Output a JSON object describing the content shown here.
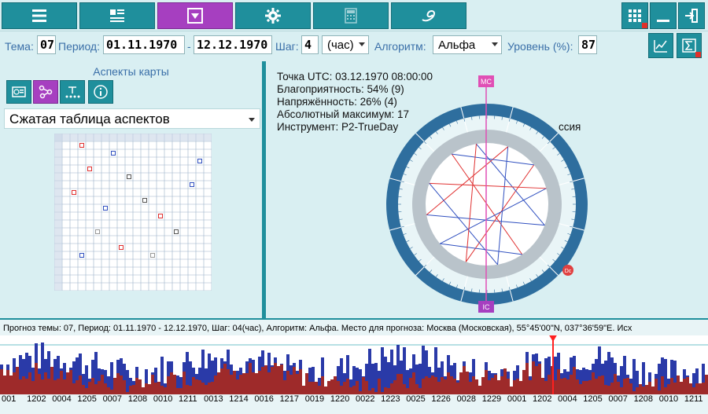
{
  "toolbar": {
    "buttons": [
      {
        "icon": "menu-icon"
      },
      {
        "icon": "list-icon"
      },
      {
        "icon": "dropdown-box-icon",
        "active": true
      },
      {
        "icon": "gear-icon"
      },
      {
        "icon": "calculator-icon"
      },
      {
        "icon": "logo-icon"
      }
    ],
    "right_buttons": [
      {
        "icon": "grid-icon"
      },
      {
        "icon": "minimize-icon"
      },
      {
        "icon": "exit-icon"
      }
    ]
  },
  "params": {
    "theme_label": "Тема:",
    "theme_value": "07",
    "period_label": "Период:",
    "period_from": "01.11.1970",
    "period_sep": "-",
    "period_to": "12.12.1970",
    "step_label": "Шаг:",
    "step_value": "4",
    "step_unit": "(час)",
    "algorithm_label": "Алгоритм:",
    "algorithm_value": "Альфа",
    "level_label": "Уровень (%):",
    "level_value": "87"
  },
  "left_panel": {
    "title": "Аспекты карты",
    "table_type": "Сжатая таблица аспектов"
  },
  "chart_info": {
    "lines": [
      "Точка UTC: 03.12.1970 08:00:00",
      "Благоприятность: 54% (9)",
      "Напряжённость: 26% (4)",
      "Абсолютный максимум: 17",
      "Инструмент: P2-TrueDay"
    ],
    "place_fragment": "ссия",
    "labels": {
      "mc": "MC",
      "ic": "IC",
      "desc": "Dc"
    }
  },
  "forecast": {
    "text": "Прогноз темы: 07, Период: 01.11.1970 - 12.12.1970, Шаг: 04(час), Алгоритм: Альфа. Место для прогноза: Москва (Московская), 55°45'00\"N, 037°36'59\"E. Исх",
    "axis_labels": [
      "001",
      "1202",
      "0004",
      "1205",
      "0007",
      "1208",
      "0010",
      "1211",
      "0013",
      "1214",
      "0016",
      "1217",
      "0019",
      "1220",
      "0022",
      "1223",
      "0025",
      "1226",
      "0028",
      "1229",
      "0001",
      "1202",
      "0004",
      "1205",
      "0007",
      "1208",
      "0010",
      "1211"
    ]
  },
  "colors": {
    "accent": "#1f8f9c",
    "active": "#a63fc0",
    "bar_blue": "#2a3aa8",
    "bar_red": "#9e2a2a",
    "panel": "#d9eff2"
  }
}
